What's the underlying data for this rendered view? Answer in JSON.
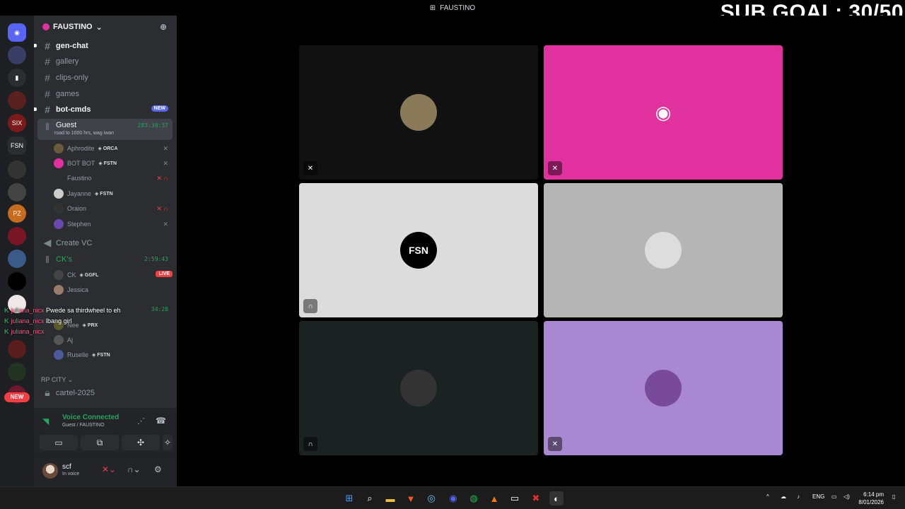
{
  "window": {
    "title": "FAUSTINO"
  },
  "stream_overlay": {
    "sub_goal": "SUB GOAL: 30/50"
  },
  "servers": [
    {
      "name": "home",
      "badge": "34",
      "color": "#5865f2",
      "glyph": "◉"
    },
    {
      "name": "server-2",
      "badge": "1",
      "color": "#3a3d66",
      "glyph": ""
    },
    {
      "name": "folder",
      "badge": "",
      "color": "#2b2d31",
      "glyph": "▮"
    },
    {
      "name": "server-4",
      "badge": "",
      "color": "#5a2020",
      "glyph": ""
    },
    {
      "name": "sixdine",
      "badge": "",
      "color": "#7a1a1a",
      "glyph": "SIX"
    },
    {
      "name": "fstn",
      "badge": "",
      "color": "#2b2d31",
      "glyph": "FSN"
    },
    {
      "name": "server-7",
      "badge": "2",
      "color": "#333",
      "glyph": ""
    },
    {
      "name": "server-8",
      "badge": "",
      "color": "#444",
      "glyph": ""
    },
    {
      "name": "pizzeria",
      "badge": "",
      "color": "#c76b1e",
      "glyph": "PZ"
    },
    {
      "name": "server-10",
      "badge": "105",
      "color": "#7a1525",
      "glyph": ""
    },
    {
      "name": "server-11",
      "badge": "31",
      "color": "#3a5a8a",
      "glyph": ""
    },
    {
      "name": "server-12",
      "badge": "",
      "color": "#000",
      "glyph": ""
    },
    {
      "name": "server-13",
      "badge": "3",
      "color": "#f0e8e8",
      "glyph": ""
    },
    {
      "name": "server-14",
      "badge": "",
      "color": "#5a1c1c",
      "glyph": ""
    },
    {
      "name": "server-15",
      "badge": "45",
      "color": "#223322",
      "glyph": ""
    },
    {
      "name": "server-16",
      "badge": "34",
      "color": "#6a1a2a",
      "glyph": ""
    }
  ],
  "servers_new": "NEW",
  "server_header": {
    "name": "FAUSTINO",
    "chevron": "⌄"
  },
  "channels": {
    "gen_chat": "gen-chat",
    "gallery": "gallery",
    "clips_only": "clips-only",
    "games": "games",
    "bot_cmds": "bot-cmds",
    "bot_cmds_badge": "NEW",
    "guest": "Guest",
    "guest_status": "road to 1000 hrs, wag iwan",
    "guest_timer": "283:39:37",
    "create_vc": "Create VC",
    "cks": "CK's",
    "cks_timer": "2:59:43",
    "third_timer": "34:28",
    "rp_city": "RP CITY",
    "cartel": "cartel-2025"
  },
  "guest_users": [
    {
      "name": "Aphrodite",
      "tag": "ORCA",
      "av": "#6a5a3a",
      "icon": "✕",
      "icon_color": ""
    },
    {
      "name": "BOT BOT",
      "tag": "FSTN",
      "av": "#e0319e",
      "icon": "✕",
      "icon_color": ""
    },
    {
      "name": "Faustino",
      "tag": "",
      "av": "#2b2d31",
      "icon": "✕ ∩",
      "icon_color": "red"
    },
    {
      "name": "Jayanne",
      "tag": "FSTN",
      "av": "#ccc",
      "icon": "",
      "icon_color": ""
    },
    {
      "name": "Oraion",
      "tag": "",
      "av": "#333",
      "icon": "✕ ∩",
      "icon_color": "red"
    },
    {
      "name": "Stephen",
      "tag": "",
      "av": "#6a4ab0",
      "icon": "✕",
      "icon_color": ""
    }
  ],
  "ck_users": [
    {
      "name": "CK",
      "tag": "GGFL",
      "av": "#444"
    },
    {
      "name": "Jessica",
      "tag": "",
      "av": "#9a7a6a"
    }
  ],
  "ck_live": "LIVE",
  "third_users": [
    {
      "name": "Nee",
      "tag": "PRX",
      "av": "#5a5a2a"
    },
    {
      "name": "Aj",
      "tag": "",
      "av": "#555"
    },
    {
      "name": "Ruselle",
      "tag": "FSTN",
      "av": "#4a5a9a"
    }
  ],
  "chat_overlay": [
    {
      "name": "juliana_nicx",
      "msg": "Pwede sa thirdwheel to eh"
    },
    {
      "name": "juliana_nicx",
      "msg": "lbang girl"
    },
    {
      "name": "juliana_nicx",
      "msg": ""
    }
  ],
  "voice_panel": {
    "title": "Voice Connected",
    "sub": "Guest / FAUSTINO"
  },
  "user": {
    "name": "scf",
    "status": "In voice"
  },
  "tiles": [
    {
      "bg": "#111111",
      "av": "#8a7a5a",
      "icon": "✕"
    },
    {
      "bg": "#e0319e",
      "av": "",
      "icon": "✕"
    },
    {
      "bg": "#dcdcdc",
      "av": "#000",
      "icon": "∩"
    },
    {
      "bg": "#b5b5b5",
      "av": "#ddd",
      "icon": ""
    },
    {
      "bg": "#1a2222",
      "av": "#333",
      "icon": "∩"
    },
    {
      "bg": "#a888d0",
      "av": "#7a4a9a",
      "icon": "✕"
    }
  ],
  "taskbar": {
    "lang": "ENG",
    "time": "6:14 pm",
    "date": "8/01/2026"
  }
}
